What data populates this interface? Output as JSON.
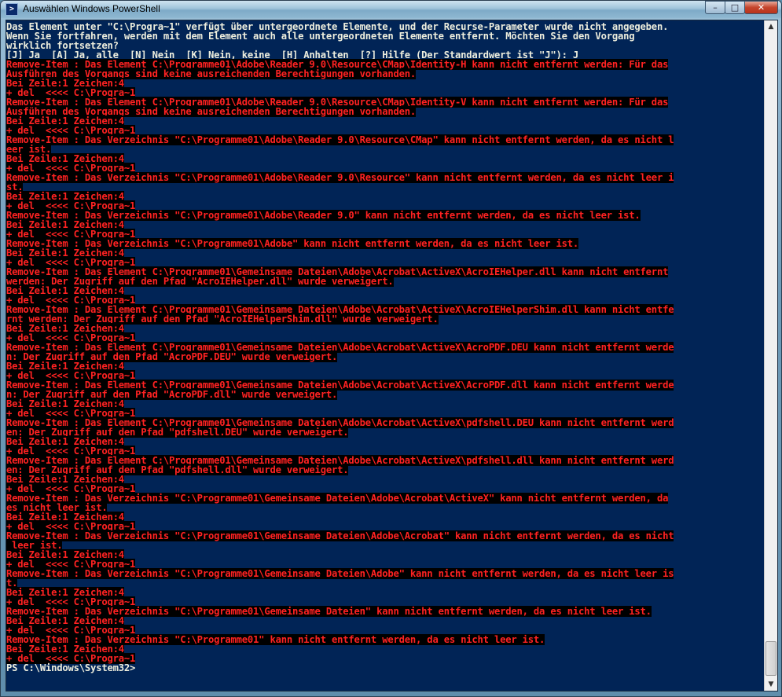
{
  "window": {
    "title": "Auswählen Windows PowerShell",
    "icon": "powershell-icon",
    "controls": {
      "minimize": "–",
      "maximize": "□",
      "close": "✕"
    }
  },
  "colors": {
    "console_background": "#012456",
    "text": "#eeeedd",
    "error_text": "#ff2222",
    "error_background": "#000000"
  },
  "console": {
    "lines": [
      {
        "text": "Das Element unter \"C:\\Progra~1\" verfügt über untergeordnete Elemente, und der Recurse-Parameter wurde nicht angegeben.",
        "style": "plain"
      },
      {
        "text": "Wenn Sie fortfahren, werden mit dem Element auch alle untergeordneten Elemente entfernt. Möchten Sie den Vorgang",
        "style": "plain"
      },
      {
        "text": "wirklich fortsetzen?",
        "style": "plain"
      },
      {
        "text": "[J] Ja  [A] Ja, alle  [N] Nein  [K] Nein, keine  [H] Anhalten  [?] Hilfe (Der Standardwert ist \"J\"): J",
        "style": "plain"
      },
      {
        "text": "Remove-Item : Das Element C:\\Programme01\\Adobe\\Reader 9.0\\Resource\\CMap\\Identity-H kann nicht entfernt werden: Für das",
        "style": "err"
      },
      {
        "text": "Ausführen des Vorgangs sind keine ausreichenden Berechtigungen vorhanden.",
        "style": "err"
      },
      {
        "text": "Bei Zeile:1 Zeichen:4",
        "style": "err"
      },
      {
        "text": "+ del  <<<< C:\\Progra~1",
        "style": "err"
      },
      {
        "text": "Remove-Item : Das Element C:\\Programme01\\Adobe\\Reader 9.0\\Resource\\CMap\\Identity-V kann nicht entfernt werden: Für das",
        "style": "err"
      },
      {
        "text": "Ausführen des Vorgangs sind keine ausreichenden Berechtigungen vorhanden.",
        "style": "err"
      },
      {
        "text": "Bei Zeile:1 Zeichen:4",
        "style": "err"
      },
      {
        "text": "+ del  <<<< C:\\Progra~1",
        "style": "err"
      },
      {
        "text": "Remove-Item : Das Verzeichnis \"C:\\Programme01\\Adobe\\Reader 9.0\\Resource\\CMap\" kann nicht entfernt werden, da es nicht l",
        "style": "err"
      },
      {
        "text": "eer ist.",
        "style": "err"
      },
      {
        "text": "Bei Zeile:1 Zeichen:4",
        "style": "err"
      },
      {
        "text": "+ del  <<<< C:\\Progra~1",
        "style": "err"
      },
      {
        "text": "Remove-Item : Das Verzeichnis \"C:\\Programme01\\Adobe\\Reader 9.0\\Resource\" kann nicht entfernt werden, da es nicht leer i",
        "style": "err"
      },
      {
        "text": "st.",
        "style": "err"
      },
      {
        "text": "Bei Zeile:1 Zeichen:4",
        "style": "err"
      },
      {
        "text": "+ del  <<<< C:\\Progra~1",
        "style": "err"
      },
      {
        "text": "Remove-Item : Das Verzeichnis \"C:\\Programme01\\Adobe\\Reader 9.0\" kann nicht entfernt werden, da es nicht leer ist.",
        "style": "err"
      },
      {
        "text": "Bei Zeile:1 Zeichen:4",
        "style": "err"
      },
      {
        "text": "+ del  <<<< C:\\Progra~1",
        "style": "err"
      },
      {
        "text": "Remove-Item : Das Verzeichnis \"C:\\Programme01\\Adobe\" kann nicht entfernt werden, da es nicht leer ist.",
        "style": "err"
      },
      {
        "text": "Bei Zeile:1 Zeichen:4",
        "style": "err"
      },
      {
        "text": "+ del  <<<< C:\\Progra~1",
        "style": "err"
      },
      {
        "text": "Remove-Item : Das Element C:\\Programme01\\Gemeinsame Dateien\\Adobe\\Acrobat\\ActiveX\\AcroIEHelper.dll kann nicht entfernt",
        "style": "err"
      },
      {
        "text": "werden: Der Zugriff auf den Pfad \"AcroIEHelper.dll\" wurde verweigert.",
        "style": "err"
      },
      {
        "text": "Bei Zeile:1 Zeichen:4",
        "style": "err"
      },
      {
        "text": "+ del  <<<< C:\\Progra~1",
        "style": "err"
      },
      {
        "text": "Remove-Item : Das Element C:\\Programme01\\Gemeinsame Dateien\\Adobe\\Acrobat\\ActiveX\\AcroIEHelperShim.dll kann nicht entfe",
        "style": "err"
      },
      {
        "text": "rnt werden: Der Zugriff auf den Pfad \"AcroIEHelperShim.dll\" wurde verweigert.",
        "style": "err"
      },
      {
        "text": "Bei Zeile:1 Zeichen:4",
        "style": "err"
      },
      {
        "text": "+ del  <<<< C:\\Progra~1",
        "style": "err"
      },
      {
        "text": "Remove-Item : Das Element C:\\Programme01\\Gemeinsame Dateien\\Adobe\\Acrobat\\ActiveX\\AcroPDF.DEU kann nicht entfernt werde",
        "style": "err"
      },
      {
        "text": "n: Der Zugriff auf den Pfad \"AcroPDF.DEU\" wurde verweigert.",
        "style": "err"
      },
      {
        "text": "Bei Zeile:1 Zeichen:4",
        "style": "err"
      },
      {
        "text": "+ del  <<<< C:\\Progra~1",
        "style": "err"
      },
      {
        "text": "Remove-Item : Das Element C:\\Programme01\\Gemeinsame Dateien\\Adobe\\Acrobat\\ActiveX\\AcroPDF.dll kann nicht entfernt werde",
        "style": "err"
      },
      {
        "text": "n: Der Zugriff auf den Pfad \"AcroPDF.dll\" wurde verweigert.",
        "style": "err"
      },
      {
        "text": "Bei Zeile:1 Zeichen:4",
        "style": "err"
      },
      {
        "text": "+ del  <<<< C:\\Progra~1",
        "style": "err"
      },
      {
        "text": "Remove-Item : Das Element C:\\Programme01\\Gemeinsame Dateien\\Adobe\\Acrobat\\ActiveX\\pdfshell.DEU kann nicht entfernt werd",
        "style": "err"
      },
      {
        "text": "en: Der Zugriff auf den Pfad \"pdfshell.DEU\" wurde verweigert.",
        "style": "err"
      },
      {
        "text": "Bei Zeile:1 Zeichen:4",
        "style": "err"
      },
      {
        "text": "+ del  <<<< C:\\Progra~1",
        "style": "err"
      },
      {
        "text": "Remove-Item : Das Element C:\\Programme01\\Gemeinsame Dateien\\Adobe\\Acrobat\\ActiveX\\pdfshell.dll kann nicht entfernt werd",
        "style": "err"
      },
      {
        "text": "en: Der Zugriff auf den Pfad \"pdfshell.dll\" wurde verweigert.",
        "style": "err"
      },
      {
        "text": "Bei Zeile:1 Zeichen:4",
        "style": "err"
      },
      {
        "text": "+ del  <<<< C:\\Progra~1",
        "style": "err"
      },
      {
        "text": "Remove-Item : Das Verzeichnis \"C:\\Programme01\\Gemeinsame Dateien\\Adobe\\Acrobat\\ActiveX\" kann nicht entfernt werden, da",
        "style": "err"
      },
      {
        "text": "es nicht leer ist.",
        "style": "err",
        "cursor_after": true
      },
      {
        "text": "Bei Zeile:1 Zeichen:4",
        "style": "err"
      },
      {
        "text": "+ del  <<<< C:\\Progra~1",
        "style": "err"
      },
      {
        "text": "Remove-Item : Das Verzeichnis \"C:\\Programme01\\Gemeinsame Dateien\\Adobe\\Acrobat\" kann nicht entfernt werden, da es nicht",
        "style": "err"
      },
      {
        "text": " leer ist.",
        "style": "err"
      },
      {
        "text": "Bei Zeile:1 Zeichen:4",
        "style": "err"
      },
      {
        "text": "+ del  <<<< C:\\Progra~1",
        "style": "err"
      },
      {
        "text": "Remove-Item : Das Verzeichnis \"C:\\Programme01\\Gemeinsame Dateien\\Adobe\" kann nicht entfernt werden, da es nicht leer is",
        "style": "err"
      },
      {
        "text": "t.",
        "style": "err"
      },
      {
        "text": "Bei Zeile:1 Zeichen:4",
        "style": "err"
      },
      {
        "text": "+ del  <<<< C:\\Progra~1",
        "style": "err"
      },
      {
        "text": "Remove-Item : Das Verzeichnis \"C:\\Programme01\\Gemeinsame Dateien\" kann nicht entfernt werden, da es nicht leer ist.",
        "style": "err"
      },
      {
        "text": "Bei Zeile:1 Zeichen:4",
        "style": "err"
      },
      {
        "text": "+ del  <<<< C:\\Progra~1",
        "style": "err"
      },
      {
        "text": "Remove-Item : Das Verzeichnis \"C:\\Programme01\" kann nicht entfernt werden, da es nicht leer ist.",
        "style": "err"
      },
      {
        "text": "Bei Zeile:1 Zeichen:4",
        "style": "err"
      },
      {
        "text": "+ del  <<<< C:\\Progra~1",
        "style": "err"
      }
    ],
    "prompt": "PS C:\\Windows\\System32> "
  },
  "scrollbar": {
    "up_arrow": "▲",
    "down_arrow": "▼"
  }
}
